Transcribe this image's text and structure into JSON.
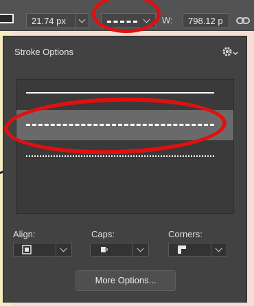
{
  "options_bar": {
    "stroke_width_value": "21.74 px",
    "width_label": "W:",
    "width_value": "798.12 p",
    "stroke_type_selected": "dashed"
  },
  "stroke_panel": {
    "title": "Stroke Options",
    "stroke_types": [
      "solid",
      "dashed",
      "dotted"
    ],
    "selected_index": 1,
    "align_label": "Align:",
    "caps_label": "Caps:",
    "corners_label": "Corners:",
    "more_options_label": "More Options..."
  },
  "colors": {
    "annotation_red": "#e01010",
    "panel_bg": "#424242",
    "selected_row": "#6a6a6a"
  },
  "icons": {
    "settings": "gear-icon",
    "link": "link-icon",
    "align": "align-inside-icon",
    "caps": "cap-square-icon",
    "corners": "corner-miter-icon"
  }
}
